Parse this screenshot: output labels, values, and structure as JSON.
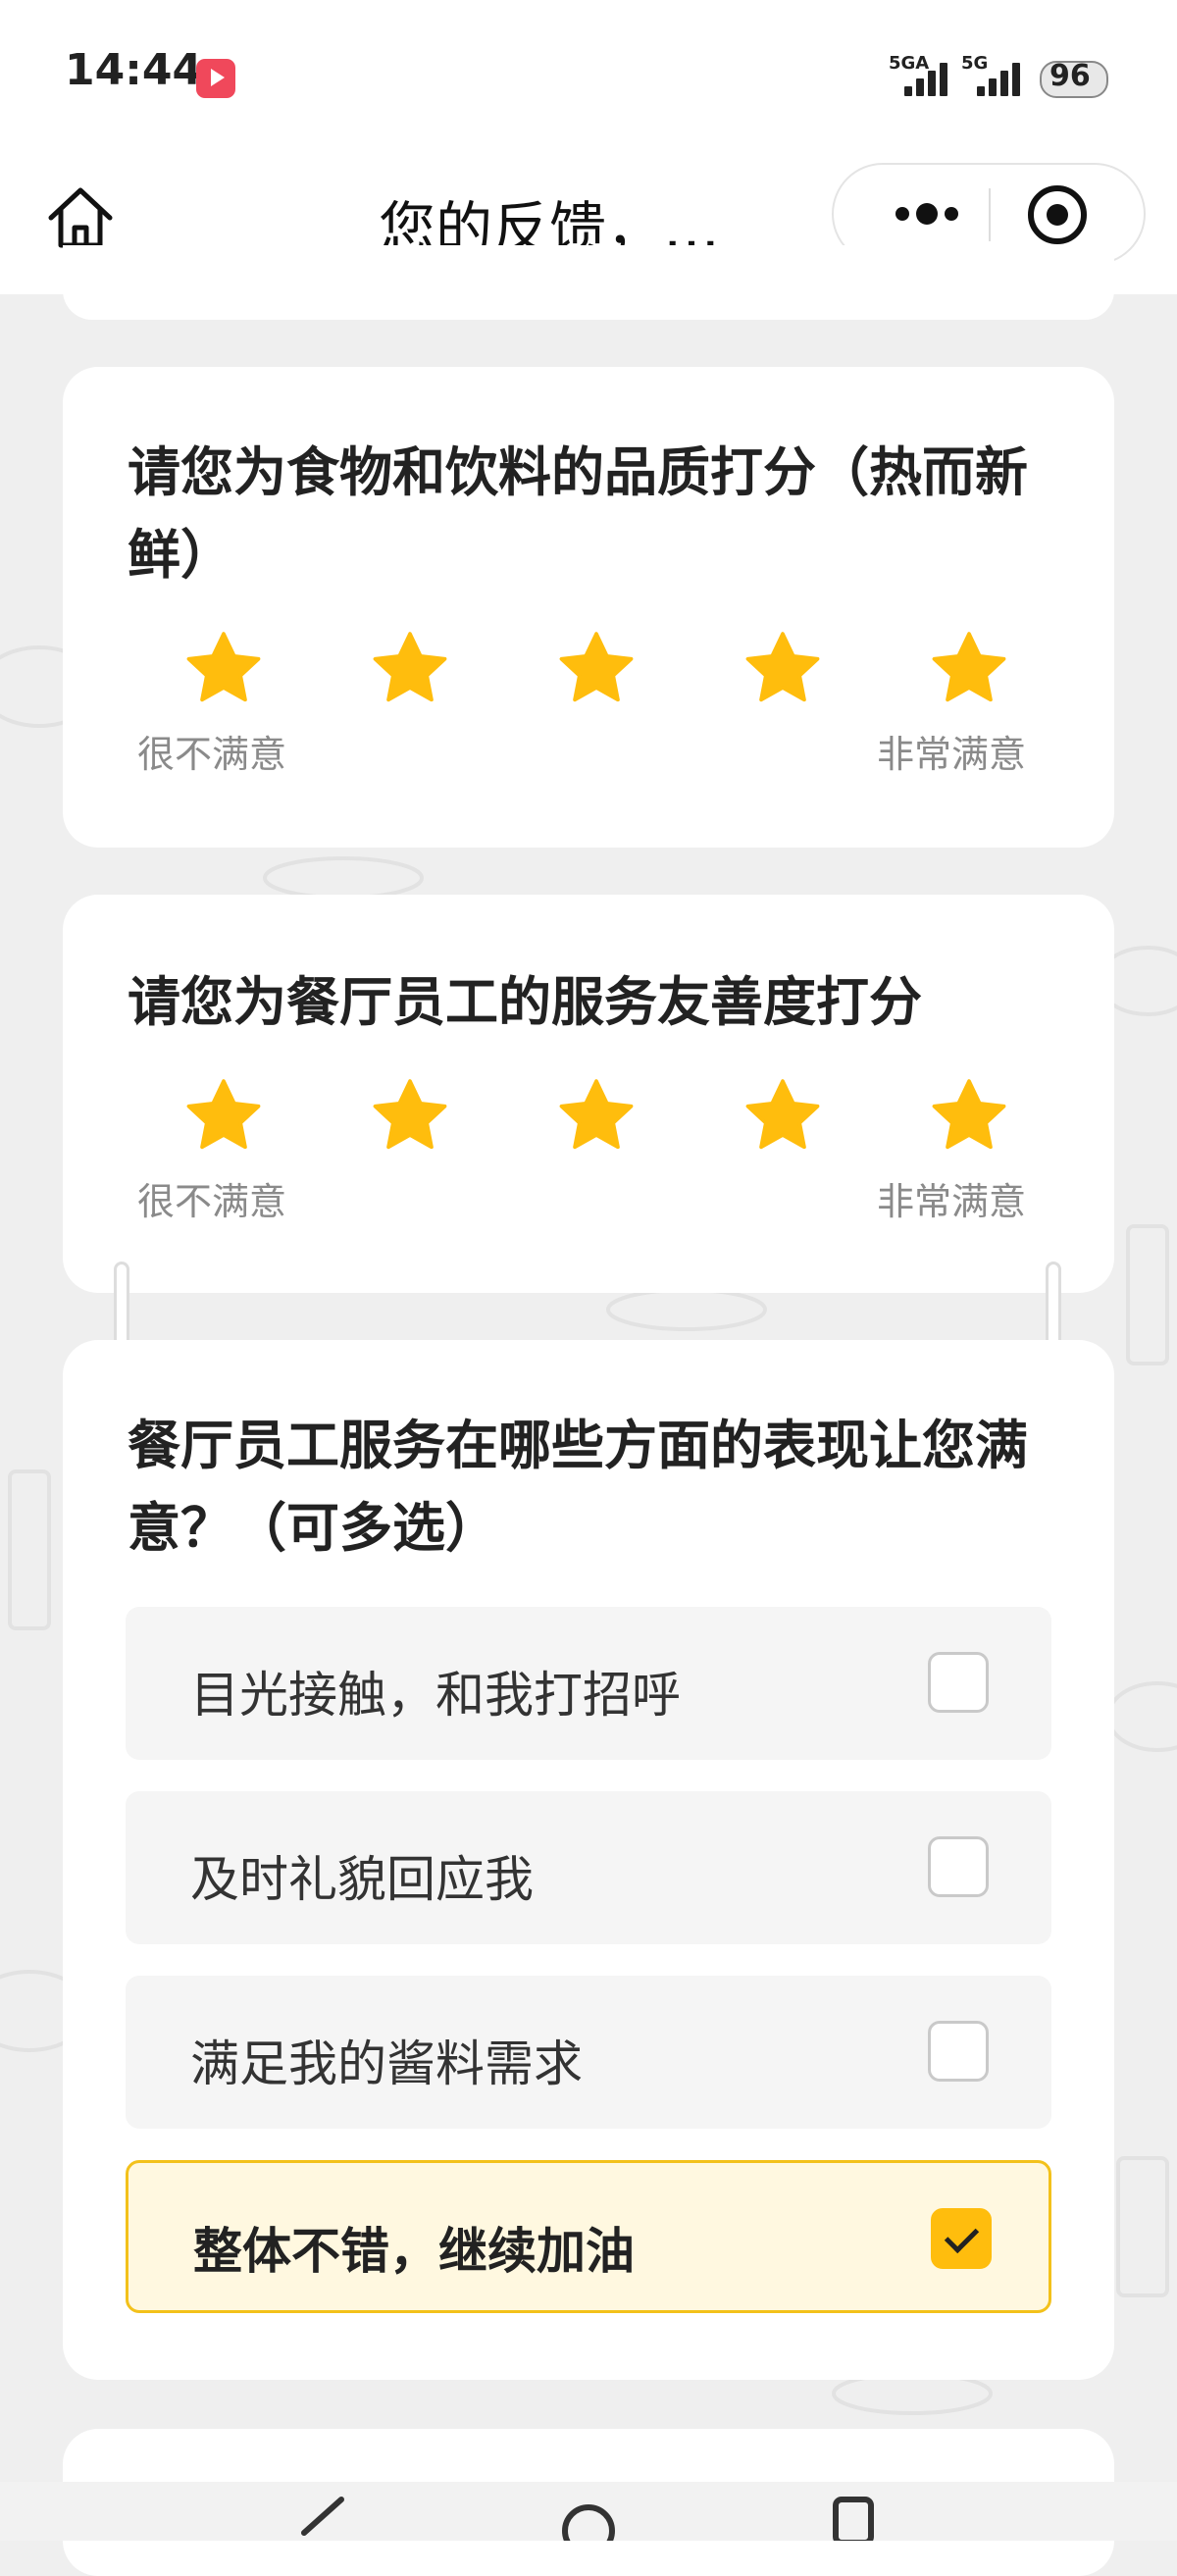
{
  "status_bar": {
    "time": "14:44",
    "network_1": "5GA",
    "network_2": "5G",
    "battery": "96"
  },
  "nav": {
    "title": "您的反馈，…"
  },
  "questions": [
    {
      "title": "请您为食物和饮料的品质打分（热而新鲜）",
      "rating": 5,
      "max_rating": 5,
      "label_low": "很不满意",
      "label_high": "非常满意"
    },
    {
      "title": "请您为餐厅员工的服务友善度打分",
      "rating": 5,
      "max_rating": 5,
      "label_low": "很不满意",
      "label_high": "非常满意"
    },
    {
      "title": "餐厅员工服务在哪些方面的表现让您满意？（可多选）",
      "options": [
        {
          "label": "目光接触，和我打招呼",
          "checked": false
        },
        {
          "label": "及时礼貌回应我",
          "checked": false
        },
        {
          "label": "满足我的酱料需求",
          "checked": false
        },
        {
          "label": "整体不错，继续加油",
          "checked": true
        }
      ]
    }
  ],
  "colors": {
    "star": "#ffbd0d",
    "accent": "#ffbd0d",
    "selected_bg": "#fff8e0",
    "selected_border": "#f3c11b"
  }
}
